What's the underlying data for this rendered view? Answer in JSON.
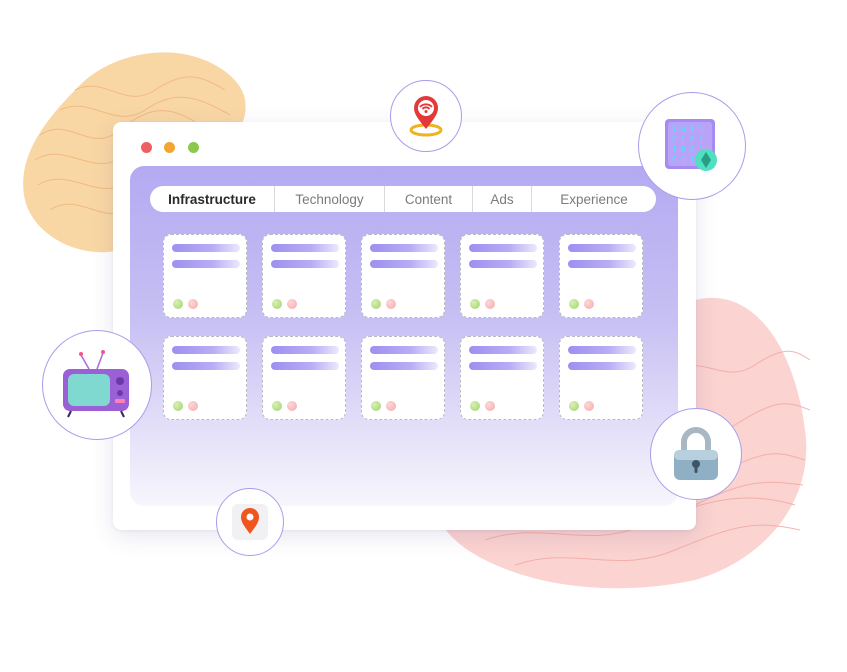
{
  "tabs": [
    {
      "label": "Infrastructure",
      "active": true
    },
    {
      "label": "Technology",
      "active": false
    },
    {
      "label": "Content",
      "active": false
    },
    {
      "label": "Ads",
      "active": false
    },
    {
      "label": "Experience",
      "active": false
    }
  ],
  "window_controls": [
    "close-dot",
    "minimize-dot",
    "maximize-dot"
  ],
  "cards": {
    "rows": 2,
    "columns": 5
  },
  "icons": [
    "wifi-location-icon",
    "binary-chip-icon",
    "retro-tv-icon",
    "padlock-icon",
    "map-pin-icon"
  ],
  "colors": {
    "accent": "#a99cea",
    "panel_top": "#b3aaf2",
    "blob_orange": "#f9d7a4",
    "blob_pink": "#fbd3d0",
    "dot_red": "#ee5f61",
    "dot_yellow": "#f3a52f",
    "dot_green": "#8bc84b"
  }
}
